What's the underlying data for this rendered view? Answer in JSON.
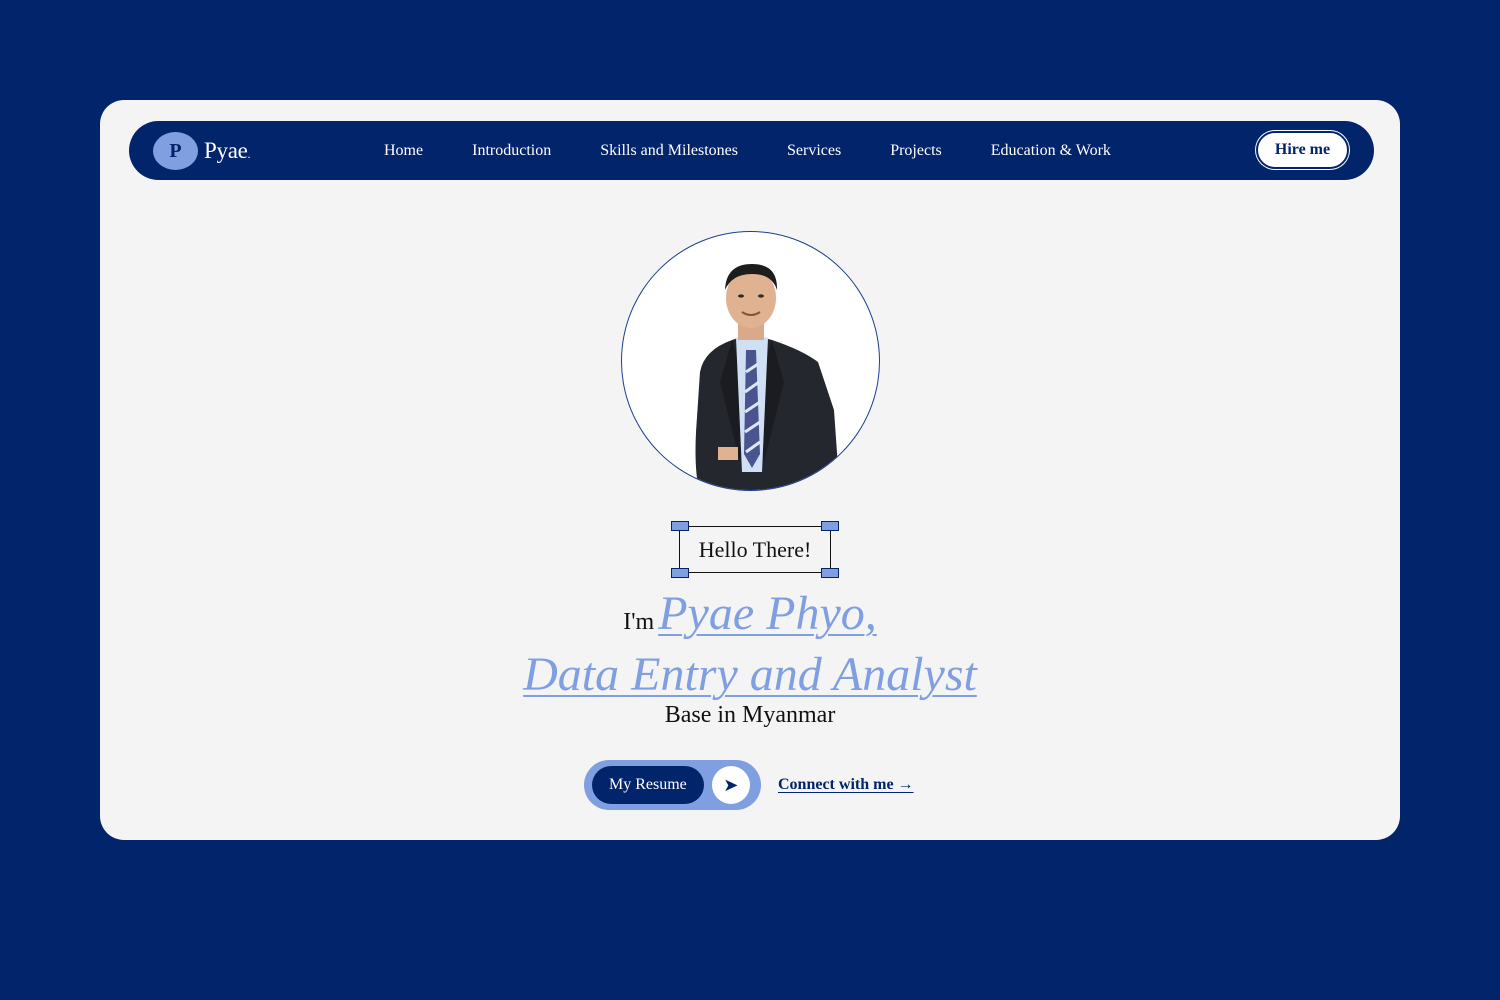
{
  "brand": {
    "badge_letter": "P",
    "name": "Pyae",
    "dot": "."
  },
  "nav": {
    "links": [
      {
        "label": "Home"
      },
      {
        "label": "Introduction"
      },
      {
        "label": "Skills and Milestones"
      },
      {
        "label": "Services"
      },
      {
        "label": "Projects"
      },
      {
        "label": "Education & Work"
      }
    ],
    "hire_label": "Hire me"
  },
  "hero": {
    "greeting": "Hello There!",
    "im": "I'm",
    "name": "Pyae Phyo,",
    "role": "Data Entry and Analyst",
    "location": "Base in Myanmar",
    "resume_label": "My Resume",
    "resume_arrow": "➤",
    "connect_label": "Connect with me →"
  },
  "colors": {
    "background": "#02246b",
    "card": "#f4f4f4",
    "accent": "#7f9fe0",
    "text": "#111111"
  }
}
